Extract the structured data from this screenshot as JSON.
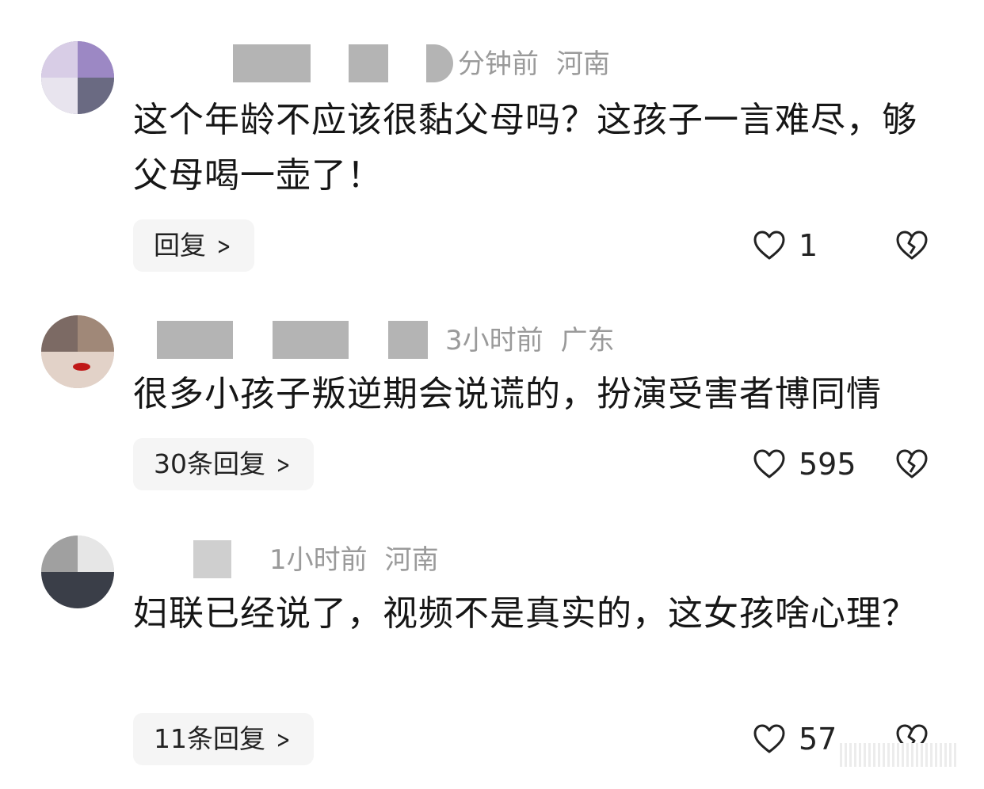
{
  "comments": [
    {
      "time": "分钟前",
      "location": "河南",
      "text": "这个年龄不应该很黏父母吗？这孩子一言难尽，够父母喝一壶了！",
      "reply_label": "回复",
      "likes": "1"
    },
    {
      "time": "3小时前",
      "location": "广东",
      "text": "很多小孩子叛逆期会说谎的，扮演受害者博同情",
      "reply_label": "30条回复",
      "likes": "595"
    },
    {
      "time": "1小时前",
      "location": "河南",
      "text": "妇联已经说了，视频不是真实的，这女孩啥心理？",
      "reply_label": "11条回复",
      "likes": "57"
    }
  ],
  "icons": {
    "like": "heart-outline-icon",
    "dislike": "broken-heart-icon",
    "reply_arrow": "chevron-right-icon"
  },
  "colors": {
    "meta_text": "#9a9a9a",
    "body_text": "#161616",
    "reply_bg": "#f5f5f5"
  }
}
